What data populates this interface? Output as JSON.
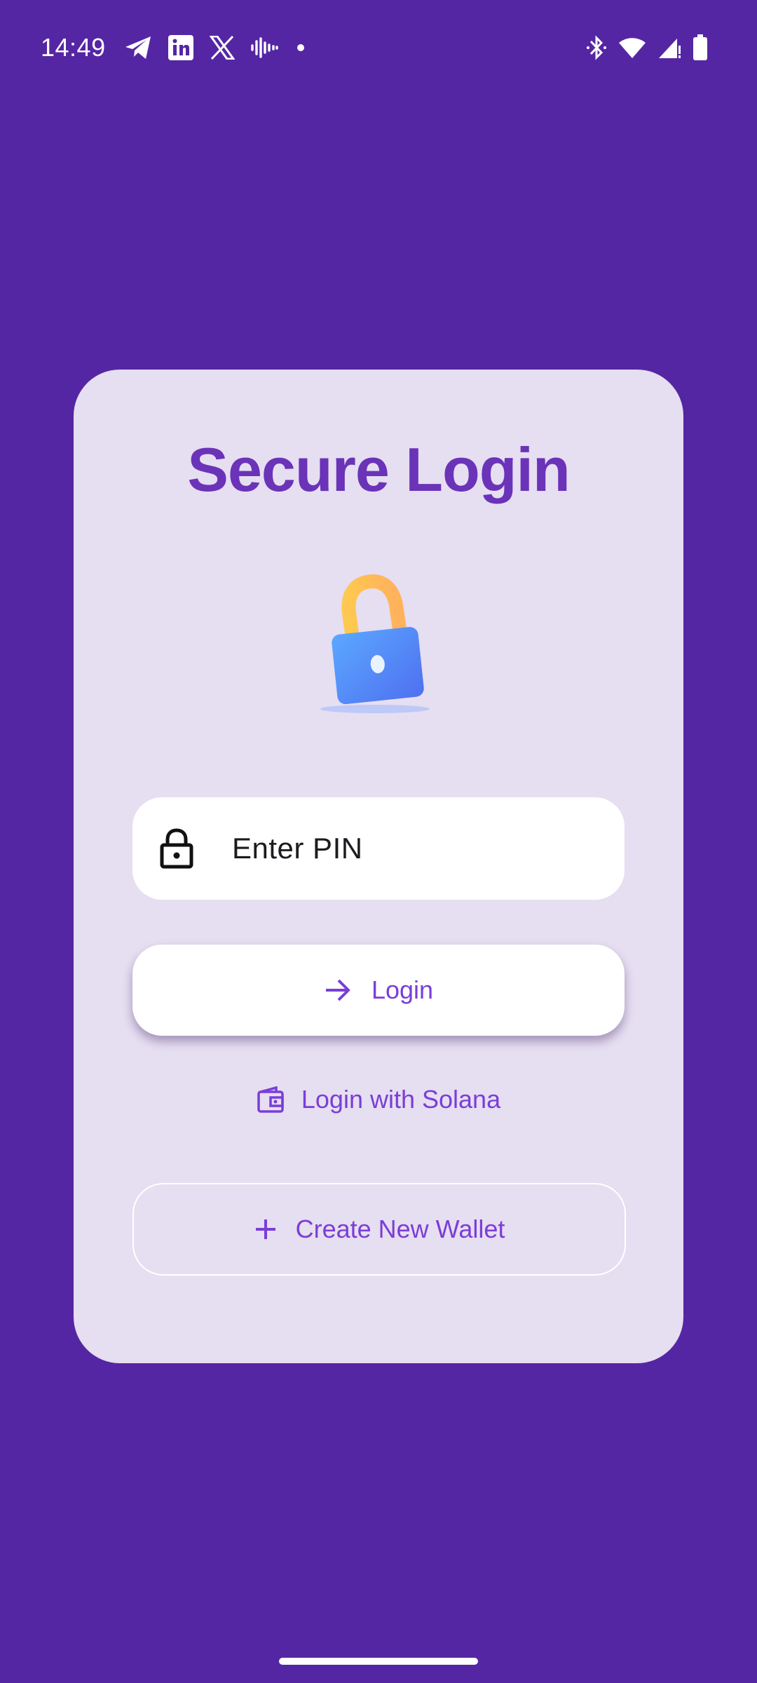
{
  "status_bar": {
    "time": "14:49",
    "left_icons": [
      "telegram-icon",
      "linkedin-icon",
      "x-icon",
      "podcast-icon",
      "dot-icon"
    ],
    "right_icons": [
      "bluetooth-icon",
      "wifi-icon",
      "signal-icon",
      "battery-icon"
    ]
  },
  "card": {
    "title": "Secure Login",
    "illustration": "padlock-illustration"
  },
  "pin": {
    "placeholder": "Enter PIN",
    "icon": "lock-icon"
  },
  "login_button": {
    "label": "Login",
    "icon": "arrow-right-icon"
  },
  "solana_link": {
    "label": "Login with Solana",
    "icon": "wallet-icon"
  },
  "create_wallet": {
    "label": "Create New Wallet",
    "icon": "plus-icon"
  },
  "colors": {
    "background": "#5526A3",
    "card": "#E6DEF1",
    "title": "#6A33B8",
    "accent": "#7A3ED6"
  }
}
